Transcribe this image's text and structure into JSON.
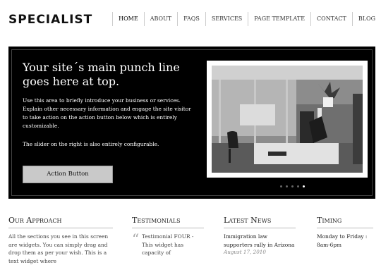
{
  "brand": {
    "logo": "SPECIALIST"
  },
  "nav": {
    "items": [
      "HOME",
      "ABOUT",
      "FAQS",
      "SERVICES",
      "PAGE TEMPLATE",
      "CONTACT",
      "BLOG"
    ]
  },
  "hero": {
    "title": "Your site´s main punch line goes here at top.",
    "paragraph1": "Use this area to briefly introduce your business or services. Explain other necessary information and engage the site visitor to take action on the action button below which is entirely customizable.",
    "paragraph2": "The slider on the right is also entirely configurable.",
    "action_label": "Action Button",
    "slider": {
      "dot_count": 5,
      "active_index": 4
    }
  },
  "sections": {
    "approach": {
      "title": "Our Approach",
      "text": "All the sections you see in this screen are widgets. You can simply drag and drop them as per your wish. This is a text widget where"
    },
    "testimonials": {
      "title": "Testimonials",
      "text": "Testimonial FOUR - This widget has capacity of"
    },
    "news": {
      "title": "Latest News",
      "headline": "Immigration law supporters rally in Arizona",
      "date": "August 17, 2010"
    },
    "timing": {
      "title": "Timing",
      "days": "Monday to Friday :",
      "hours": "8am-6pm"
    }
  },
  "colors": {
    "hero_bg": "#000000",
    "button_bg": "#c9c9c9"
  }
}
